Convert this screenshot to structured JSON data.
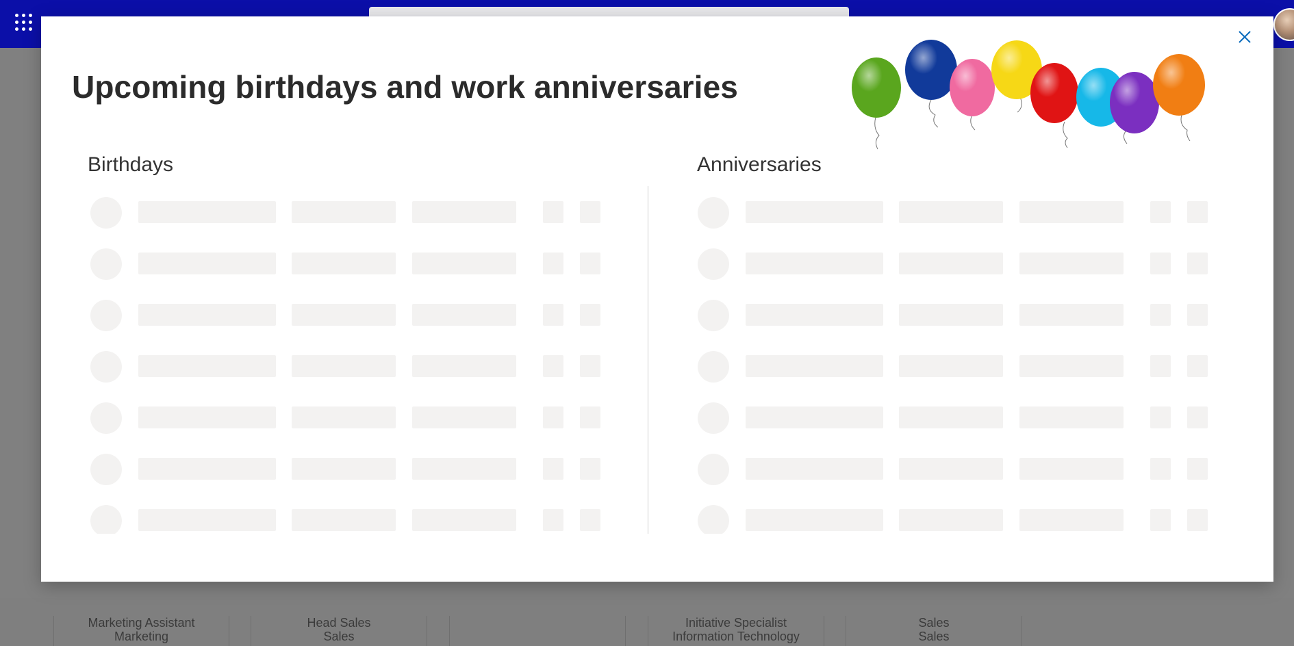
{
  "suitebar": {
    "waffle_icon": "app-launcher-icon",
    "search_icon": "search-icon",
    "avatar_icon": "user-avatar",
    "color": "#0b0fa8"
  },
  "background_cards": [
    {
      "line1": "Marketing Assistant",
      "line2": "Marketing"
    },
    {
      "line1": "Head Sales",
      "line2": "Sales"
    },
    {
      "line1": "",
      "line2": ""
    },
    {
      "line1": "Initiative Specialist",
      "line2": "Information Technology"
    },
    {
      "line1": "Sales",
      "line2": "Sales"
    }
  ],
  "modal": {
    "title": "Upcoming birthdays and work anniversaries",
    "close_icon": "close-icon",
    "decoration": "balloons-image",
    "birthdays": {
      "title": "Birthdays",
      "loading_rows": 7
    },
    "anniversaries": {
      "title": "Anniversaries",
      "loading_rows": 7
    },
    "skeleton_color": "#f3f2f1",
    "accent_color": "#0b6cbd"
  }
}
